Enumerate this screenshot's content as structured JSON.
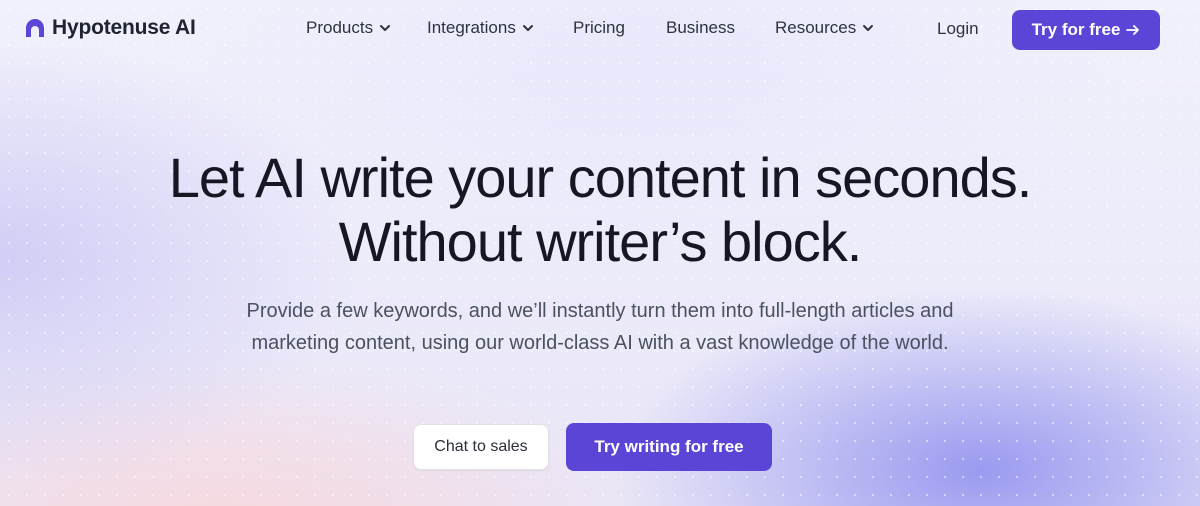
{
  "brand": {
    "name": "Hypotenuse AI",
    "accent": "#5b45d6"
  },
  "nav": {
    "items": [
      {
        "label": "Products",
        "icon": "chevron-down-icon"
      },
      {
        "label": "Integrations",
        "icon": "chevron-down-icon"
      },
      {
        "label": "Pricing"
      },
      {
        "label": "Business"
      },
      {
        "label": "Resources",
        "icon": "chevron-down-icon"
      }
    ],
    "login": "Login",
    "cta": "Try for free",
    "cta_icon": "arrow-right-icon"
  },
  "hero": {
    "title_line1": "Let AI write your content in seconds.",
    "title_line2": "Without writer’s block.",
    "sub_line1": "Provide a few keywords, and we’ll instantly turn them into full-length articles and",
    "sub_line2": "marketing content, using our world-class AI with a vast knowledge of the world.",
    "secondary_button": "Chat to sales",
    "primary_button": "Try writing for free"
  }
}
